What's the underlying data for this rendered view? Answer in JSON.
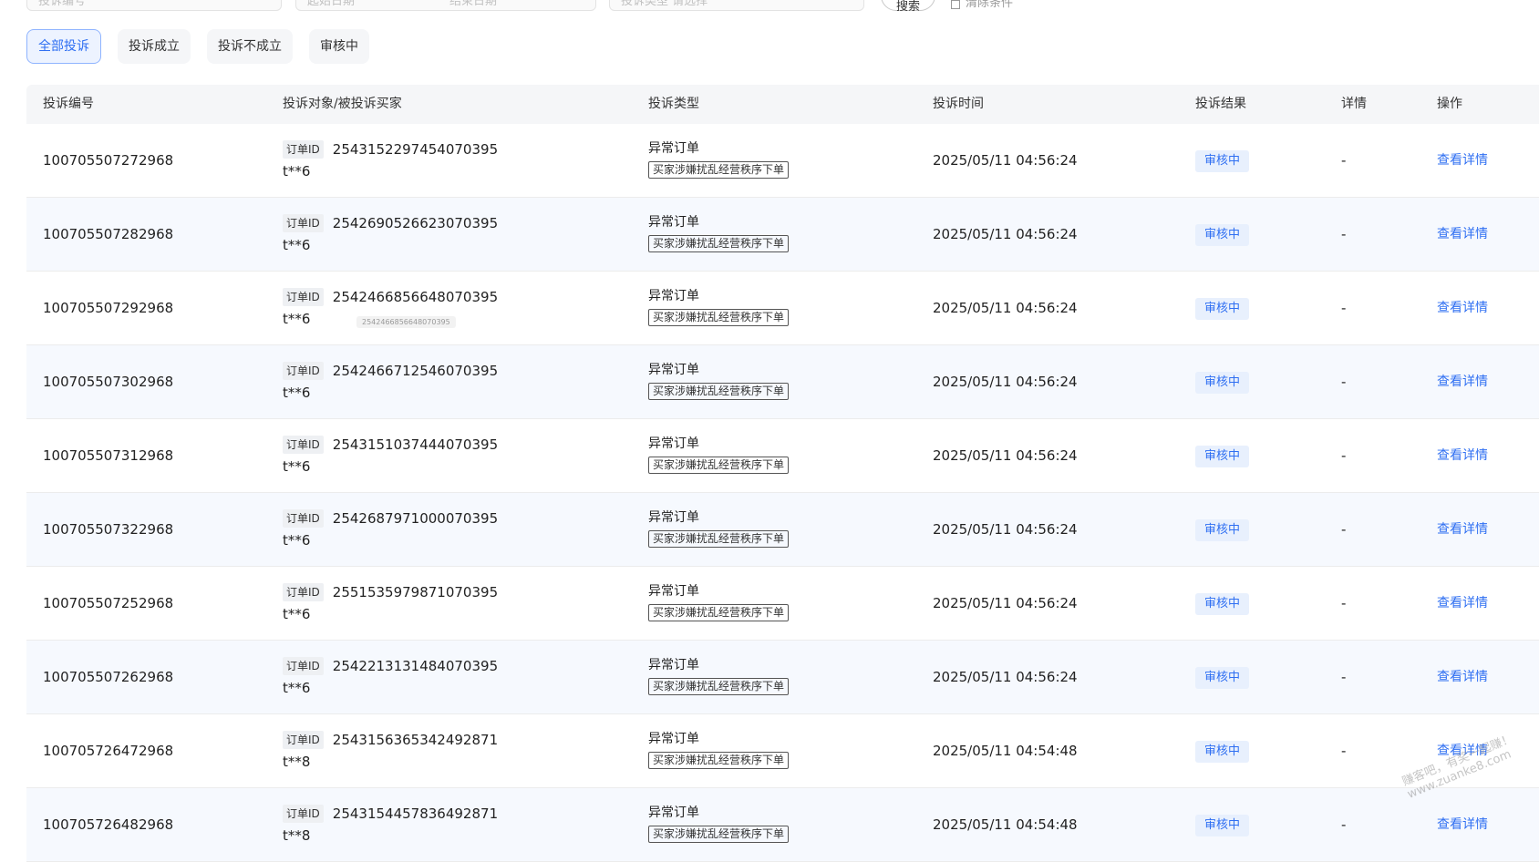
{
  "filters": {
    "complaint_id_placeholder": "投诉编号",
    "start_date_placeholder": "起始日期",
    "end_date_placeholder": "结束日期",
    "type_placeholder": "投诉类型 请选择",
    "search_label": "搜索",
    "clear_label": "清除条件"
  },
  "tabs": [
    {
      "label": "全部投诉",
      "active": true
    },
    {
      "label": "投诉成立",
      "active": false
    },
    {
      "label": "投诉不成立",
      "active": false
    },
    {
      "label": "审核中",
      "active": false
    }
  ],
  "table": {
    "headers": {
      "id": "投诉编号",
      "object": "投诉对象/被投诉买家",
      "type": "投诉类型",
      "time": "投诉时间",
      "result": "投诉结果",
      "detail": "详情",
      "action": "操作"
    },
    "order_tag": "订单ID",
    "rows": [
      {
        "id": "100705507272968",
        "order_id": "2543152297454070395",
        "buyer": "t**6",
        "type": "异常订单",
        "type_tag": "买家涉嫌扰乱经营秩序下单",
        "time": "2025/05/11 04:56:24",
        "result": "审核中",
        "detail": "-",
        "action": "查看详情"
      },
      {
        "id": "100705507282968",
        "order_id": "2542690526623070395",
        "buyer": "t**6",
        "type": "异常订单",
        "type_tag": "买家涉嫌扰乱经营秩序下单",
        "time": "2025/05/11 04:56:24",
        "result": "审核中",
        "detail": "-",
        "action": "查看详情"
      },
      {
        "id": "100705507292968",
        "order_id": "2542466856648070395",
        "buyer": "t**6",
        "type": "异常订单",
        "type_tag": "买家涉嫌扰乱经营秩序下单",
        "time": "2025/05/11 04:56:24",
        "result": "审核中",
        "detail": "-",
        "action": "查看详情",
        "tooltip": "2542466856648070395"
      },
      {
        "id": "100705507302968",
        "order_id": "2542466712546070395",
        "buyer": "t**6",
        "type": "异常订单",
        "type_tag": "买家涉嫌扰乱经营秩序下单",
        "time": "2025/05/11 04:56:24",
        "result": "审核中",
        "detail": "-",
        "action": "查看详情"
      },
      {
        "id": "100705507312968",
        "order_id": "2543151037444070395",
        "buyer": "t**6",
        "type": "异常订单",
        "type_tag": "买家涉嫌扰乱经营秩序下单",
        "time": "2025/05/11 04:56:24",
        "result": "审核中",
        "detail": "-",
        "action": "查看详情"
      },
      {
        "id": "100705507322968",
        "order_id": "2542687971000070395",
        "buyer": "t**6",
        "type": "异常订单",
        "type_tag": "买家涉嫌扰乱经营秩序下单",
        "time": "2025/05/11 04:56:24",
        "result": "审核中",
        "detail": "-",
        "action": "查看详情"
      },
      {
        "id": "100705507252968",
        "order_id": "2551535979871070395",
        "buyer": "t**6",
        "type": "异常订单",
        "type_tag": "买家涉嫌扰乱经营秩序下单",
        "time": "2025/05/11 04:56:24",
        "result": "审核中",
        "detail": "-",
        "action": "查看详情"
      },
      {
        "id": "100705507262968",
        "order_id": "2542213131484070395",
        "buyer": "t**6",
        "type": "异常订单",
        "type_tag": "买家涉嫌扰乱经营秩序下单",
        "time": "2025/05/11 04:56:24",
        "result": "审核中",
        "detail": "-",
        "action": "查看详情"
      },
      {
        "id": "100705726472968",
        "order_id": "2543156365342492871",
        "buyer": "t**8",
        "type": "异常订单",
        "type_tag": "买家涉嫌扰乱经营秩序下单",
        "time": "2025/05/11 04:54:48",
        "result": "审核中",
        "detail": "-",
        "action": "查看详情"
      },
      {
        "id": "100705726482968",
        "order_id": "2543154457836492871",
        "buyer": "t**8",
        "type": "异常订单",
        "type_tag": "买家涉嫌扰乱经营秩序下单",
        "time": "2025/05/11 04:54:48",
        "result": "审核中",
        "detail": "-",
        "action": "查看详情"
      }
    ]
  },
  "watermark": {
    "line1": "赚客吧，有奖一起赚！",
    "line2": "www.zuanke8.com"
  },
  "colors": {
    "accent": "#2f6ff2",
    "badge_bg": "#e8f0fd",
    "header_bg": "#f5f6f8",
    "alt_row_bg": "#f6f9fe"
  }
}
